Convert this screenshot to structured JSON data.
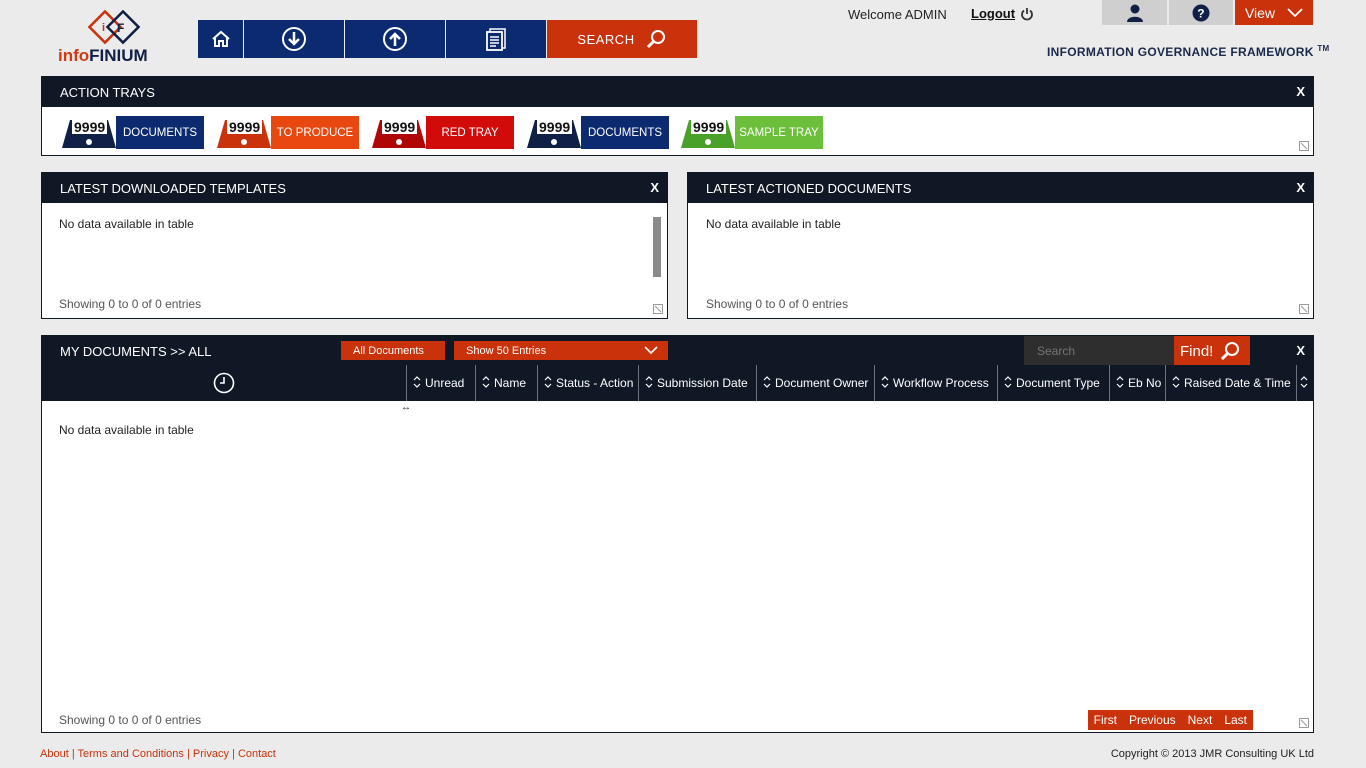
{
  "app": {
    "logo_text_info": "info",
    "logo_text_finium": "FINIUM",
    "logo_mark": "iF"
  },
  "nav": {
    "search_label": "SEARCH"
  },
  "header": {
    "welcome": "Welcome ADMIN",
    "logout": "Logout",
    "view": "View",
    "framework": "INFORMATION GOVERNANCE FRAMEWORK",
    "tm": "TM"
  },
  "action_trays": {
    "title": "ACTION TRAYS",
    "close": "X",
    "trays": [
      {
        "count": "9999",
        "label": "DOCUMENTS",
        "color": "#0c2a70",
        "tab_color": "#0f1f45"
      },
      {
        "count": "9999",
        "label": "TO PRODUCE",
        "color": "#e8470f",
        "tab_color": "#c9320b"
      },
      {
        "count": "9999",
        "label": "RED TRAY",
        "color": "#d10a0a",
        "tab_color": "#b10606"
      },
      {
        "count": "9999",
        "label": "DOCUMENTS",
        "color": "#0c2a70",
        "tab_color": "#0f1f45"
      },
      {
        "count": "9999",
        "label": "SAMPLE TRAY",
        "color": "#6cbf3b",
        "tab_color": "#4aa12a"
      }
    ]
  },
  "latest_templates": {
    "title": "LATEST DOWNLOADED TEMPLATES",
    "close": "X",
    "empty": "No data available in table",
    "showing": "Showing 0 to 0 of 0 entries"
  },
  "latest_actioned": {
    "title": "LATEST ACTIONED DOCUMENTS",
    "close": "X",
    "empty": "No data available in table",
    "showing": "Showing 0 to 0 of 0 entries"
  },
  "my_documents": {
    "title": "MY DOCUMENTS >> ALL",
    "filter": "All Documents",
    "entries": "Show 50 Entries",
    "search_placeholder": "Search",
    "find": "Find!",
    "close": "X",
    "columns": [
      "Unread",
      "Name",
      "Status - Action",
      "Submission Date",
      "Document Owner",
      "Workflow Process",
      "Document Type",
      "Eb No",
      "Raised Date & Time"
    ],
    "empty": "No data available in table",
    "showing": "Showing 0 to 0 of 0 entries",
    "pager": {
      "first": "First",
      "previous": "Previous",
      "next": "Next",
      "last": "Last"
    }
  },
  "footer": {
    "about": "About",
    "terms": "Terms and Conditions",
    "privacy": "Privacy",
    "contact": "Contact",
    "sep": "|",
    "copyright": "Copyright © 2013 JMR Consulting UK Ltd"
  },
  "colors": {
    "navy": "#0c2a70",
    "accent": "#c9320b",
    "dark": "#101826"
  },
  "icons": [
    "home-icon",
    "download-icon",
    "upload-icon",
    "documents-icon",
    "search-icon",
    "power-icon",
    "user-icon",
    "help-icon",
    "chevron-down-icon",
    "clock-icon",
    "sort-icon",
    "resize-icon"
  ]
}
